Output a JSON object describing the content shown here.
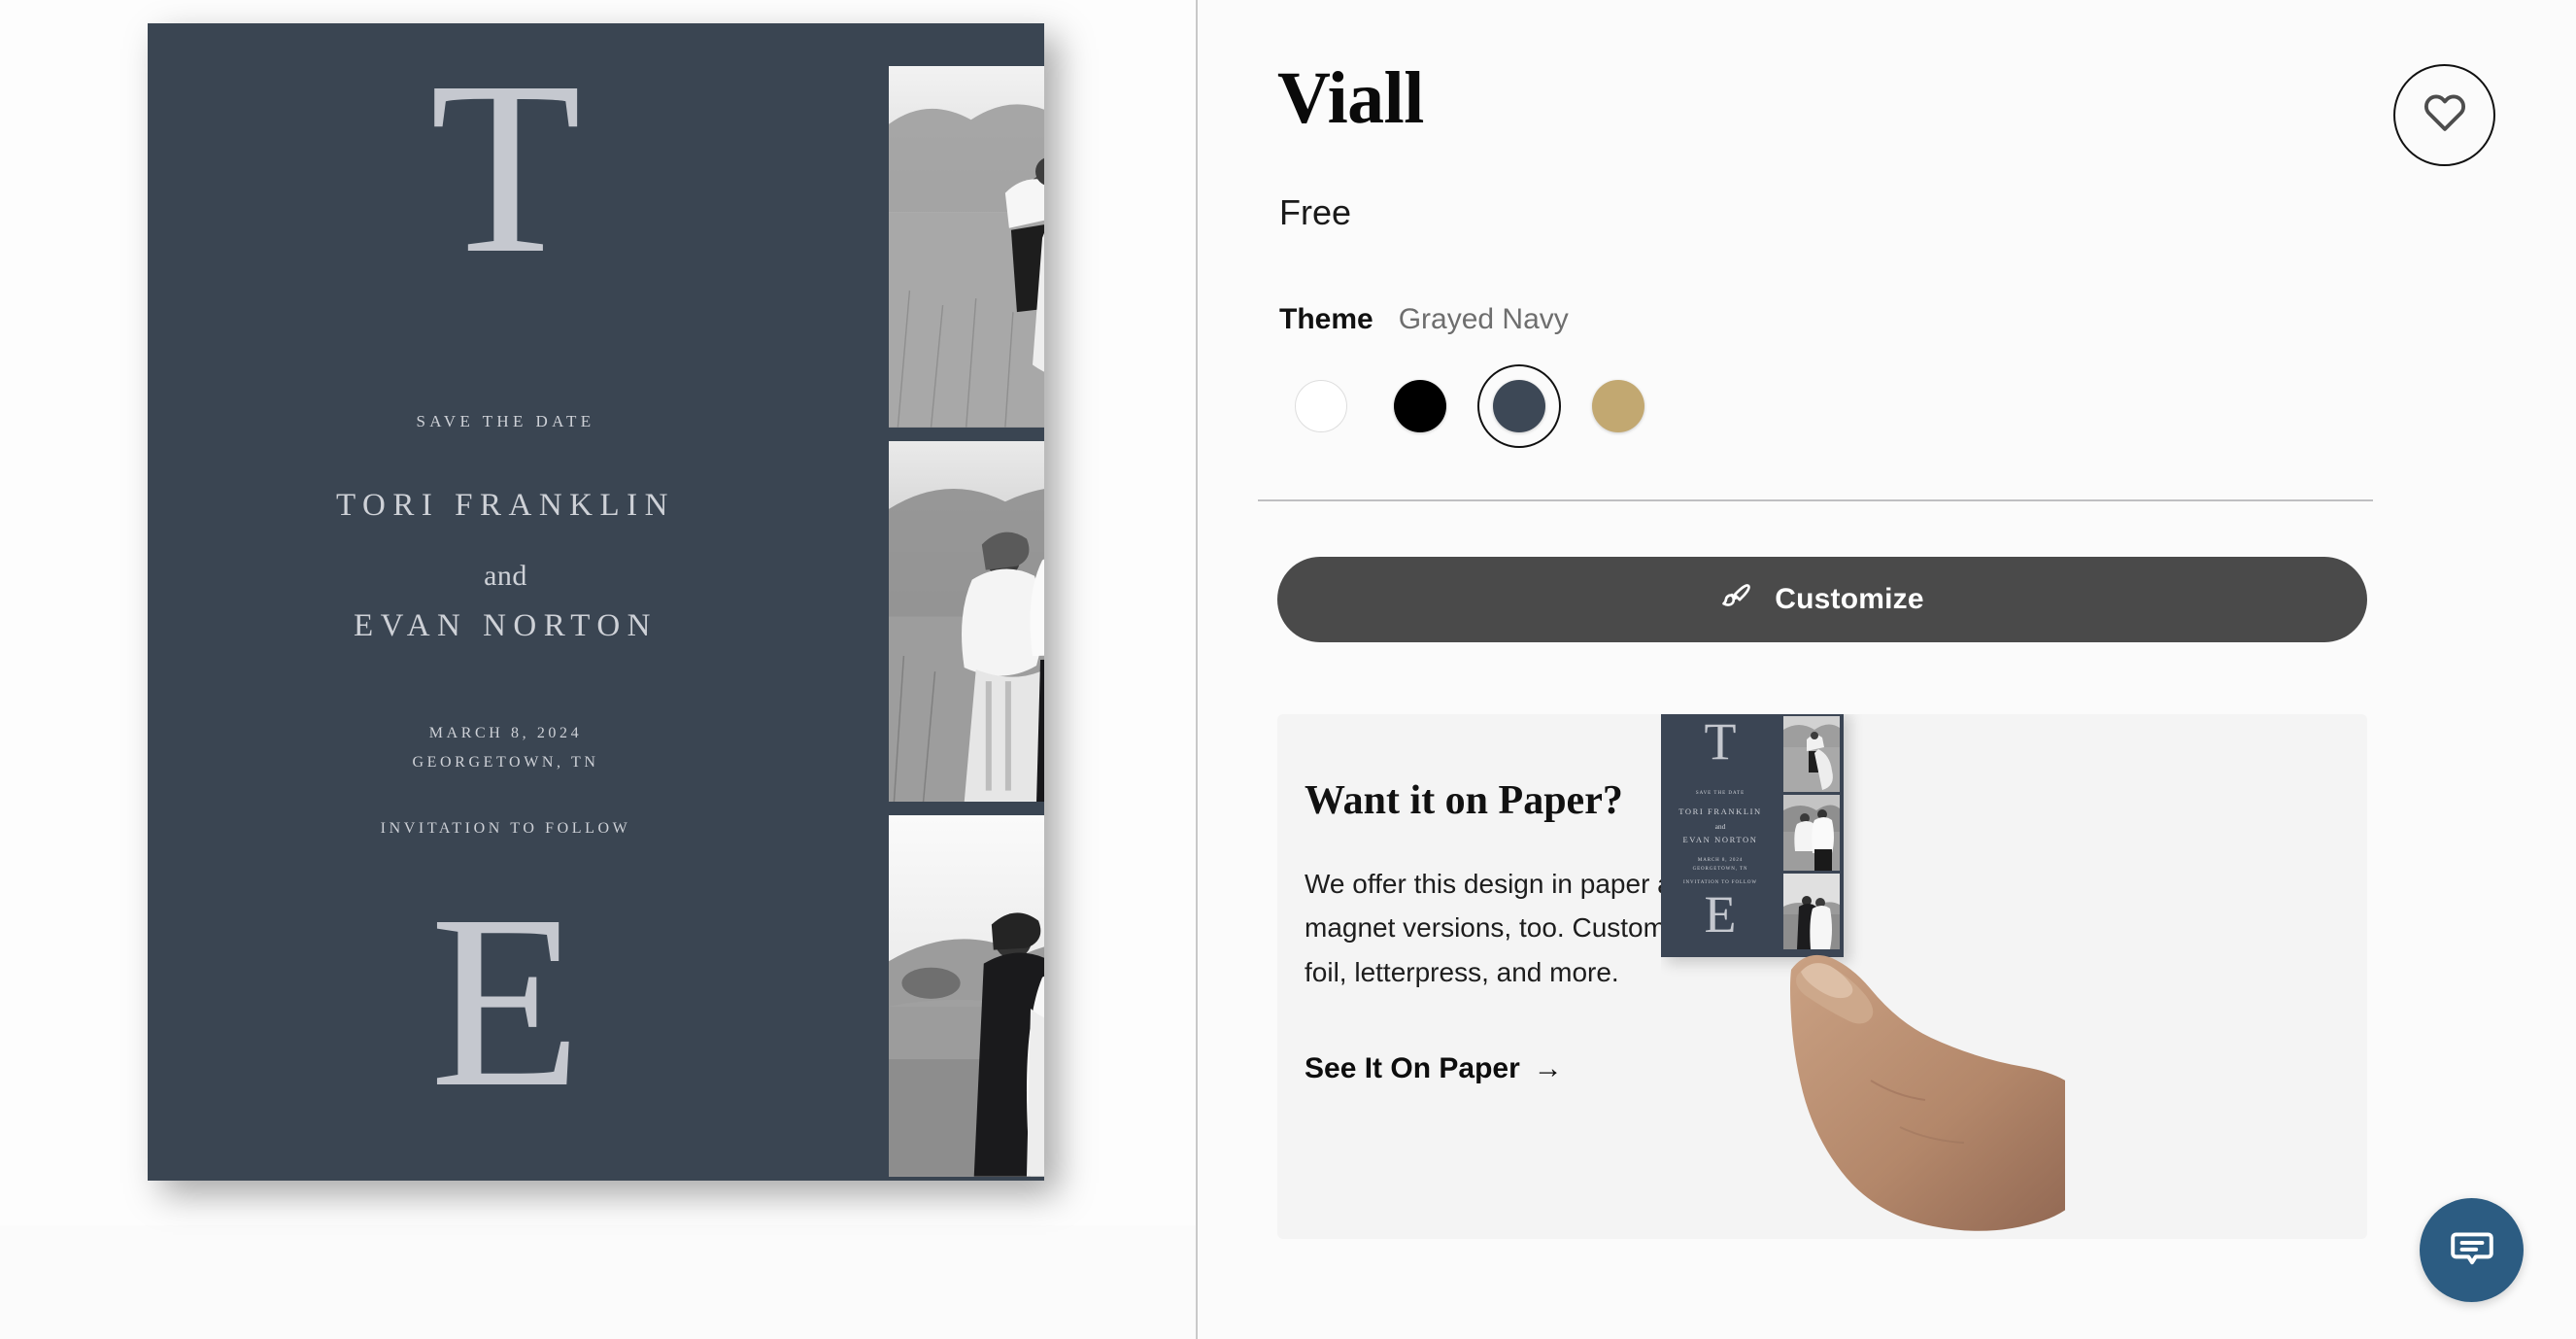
{
  "design": {
    "title": "Viall",
    "price": "Free",
    "favorite_icon": "heart-icon"
  },
  "theme": {
    "label": "Theme",
    "selected_name": "Grayed Navy",
    "swatches": [
      {
        "name": "White",
        "color": "#ffffff",
        "selected": false
      },
      {
        "name": "Black",
        "color": "#000000",
        "selected": false
      },
      {
        "name": "Grayed Navy",
        "color": "#3d4856",
        "selected": true
      },
      {
        "name": "Gold",
        "color": "#c2a871",
        "selected": false
      }
    ]
  },
  "customize": {
    "label": "Customize",
    "icon": "paintbrush-icon",
    "background": "#4a4a4a"
  },
  "paper_promo": {
    "heading": "Want it on Paper?",
    "body": "We offer this design in paper and magnet versions, too. Customize with foil, letterpress, and more.",
    "link_label": "See It On Paper",
    "link_arrow": "→"
  },
  "card": {
    "background": "#3a4552",
    "text_color": "#ced1d7",
    "monogram_top": "T",
    "monogram_bottom": "E",
    "save_the_date": "SAVE THE DATE",
    "name_first": "TORI FRANKLIN",
    "conjunction": "and",
    "name_second": "EVAN NORTON",
    "date": "MARCH 8, 2024",
    "location": "GEORGETOWN, TN",
    "follow_up": "INVITATION TO FOLLOW",
    "photos": [
      {
        "alt": "couple embracing in tall grass"
      },
      {
        "alt": "couple standing together in field"
      },
      {
        "alt": "couple kissing on a hillside"
      }
    ]
  },
  "chat": {
    "icon": "chat-bubble-icon",
    "color": "#2c5c82"
  }
}
